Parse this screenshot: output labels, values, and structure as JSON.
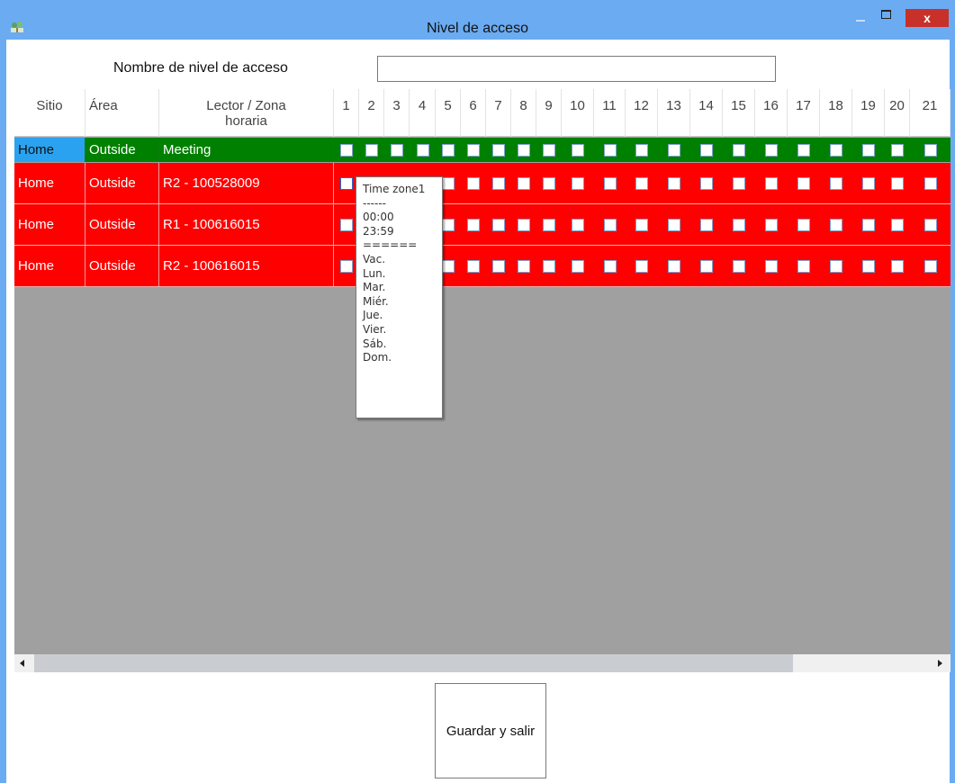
{
  "window": {
    "title": "Nivel de acceso",
    "close_label": "x"
  },
  "form": {
    "name_label": "Nombre de nivel de acceso",
    "name_value": ""
  },
  "grid": {
    "headers": {
      "sitio": "Sitio",
      "area": "Área",
      "lector": "Lector / Zona horaria"
    },
    "zone_columns": [
      "1",
      "2",
      "3",
      "4",
      "5",
      "6",
      "7",
      "8",
      "9",
      "10",
      "11",
      "12",
      "13",
      "14",
      "15",
      "16",
      "17",
      "18",
      "19",
      "20",
      "21"
    ],
    "rows": [
      {
        "sitio": "Home",
        "area": "Outside",
        "lector": "Meeting",
        "color": "green",
        "selected": true
      },
      {
        "sitio": "Home",
        "area": "Outside",
        "lector": "R2 - 100528009",
        "color": "red",
        "selected": false
      },
      {
        "sitio": "Home",
        "area": "Outside",
        "lector": "R1 - 100616015",
        "color": "red",
        "selected": false
      },
      {
        "sitio": "Home",
        "area": "Outside",
        "lector": "R2 - 100616015",
        "color": "red",
        "selected": false
      }
    ],
    "row_colors": {
      "green": "#008000",
      "red": "#ff0000",
      "selected_cell": "#2aa2ef"
    }
  },
  "tooltip": {
    "lines": [
      "Time zone1",
      "------",
      "00:00",
      "23:59",
      "======",
      "Vac.",
      "Lun.",
      "Mar.",
      "Miér.",
      "Jue.",
      "Vier.",
      "Sáb.",
      "Dom."
    ]
  },
  "actions": {
    "save_label": "Guardar y salir"
  }
}
